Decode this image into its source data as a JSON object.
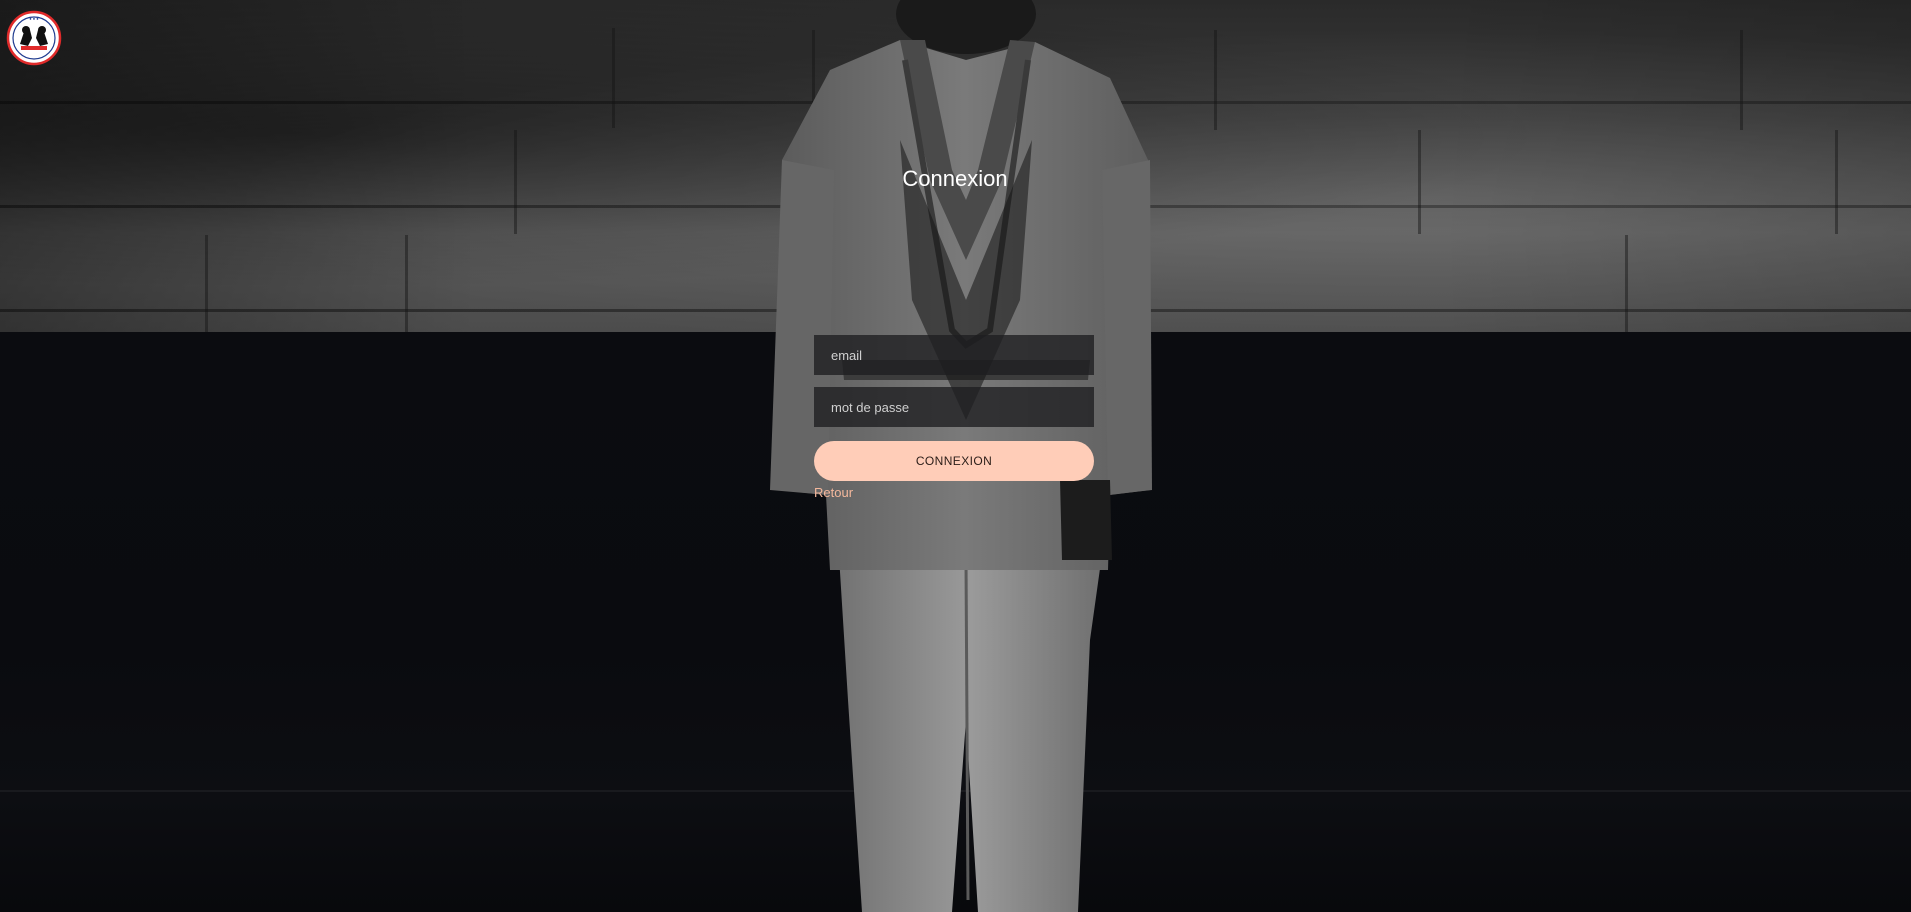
{
  "brand": {
    "logo_icon": "boxing-club-logo-icon",
    "accent_color": "#e02a2a",
    "secondary_color": "#1f3b8f"
  },
  "background": {
    "subject": "martial-arts-figure-background",
    "wall_color": "#4a4a4a",
    "floor_color": "#0b0c10"
  },
  "login": {
    "title": "Connexion",
    "email_placeholder": "email",
    "password_placeholder": "mot de passe",
    "submit_label": "CONNEXION",
    "back_label": "Retour",
    "button_color": "#ffcdb8",
    "link_color": "#f4b89c"
  }
}
